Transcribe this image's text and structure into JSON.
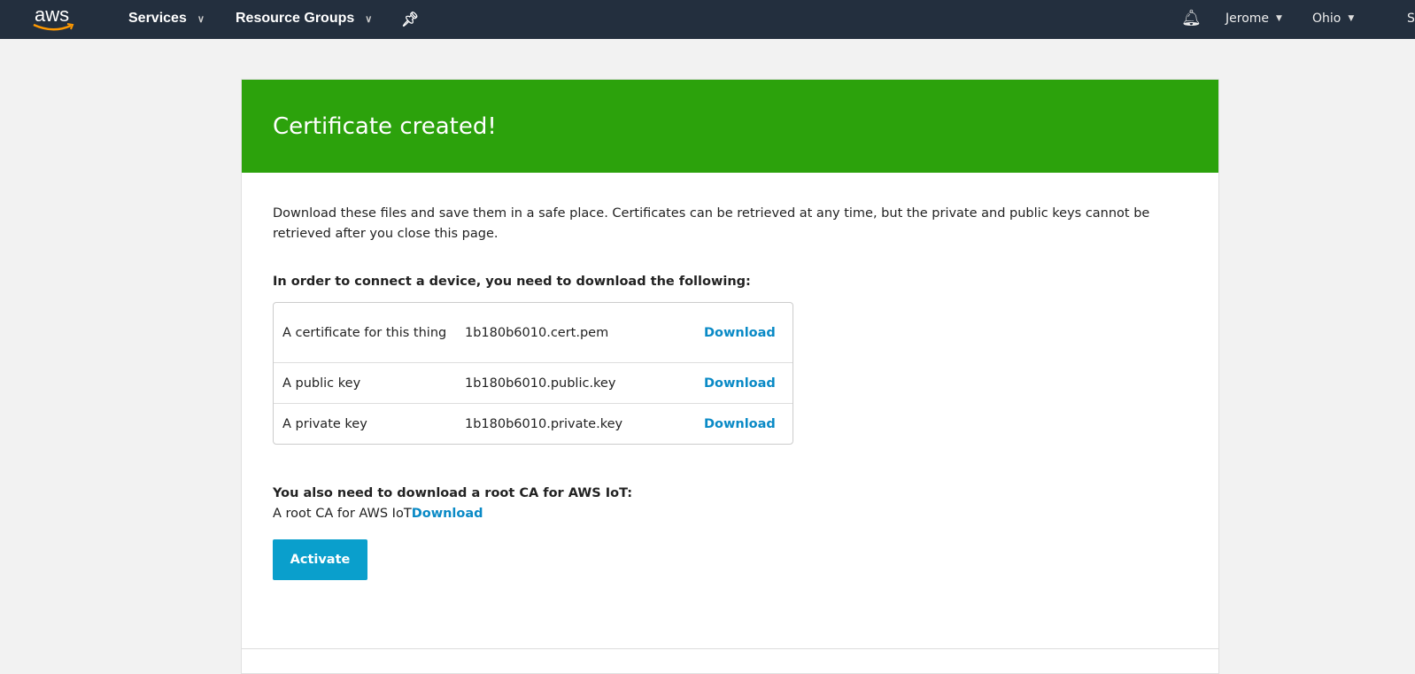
{
  "topbar": {
    "logo": "aws",
    "services": "Services",
    "resource_groups": "Resource Groups",
    "user": "Jerome",
    "region": "Ohio",
    "support": "S"
  },
  "banner": {
    "title": "Certificate created!"
  },
  "description": "Download these files and save them in a safe place. Certificates can be retrieved at any time, but the private and public keys cannot be retrieved after you close this page.",
  "files_heading": "In order to connect a device, you need to download the following:",
  "files": [
    {
      "label": "A certificate for this thing",
      "file": "1b180b6010.cert.pem",
      "action": "Download"
    },
    {
      "label": "A public key",
      "file": "1b180b6010.public.key",
      "action": "Download"
    },
    {
      "label": "A private key",
      "file": "1b180b6010.private.key",
      "action": "Download"
    }
  ],
  "root_ca": {
    "heading": "You also need to download a root CA for AWS IoT:",
    "label": "A root CA for AWS IoT",
    "action": "Download"
  },
  "activate_label": "Activate"
}
